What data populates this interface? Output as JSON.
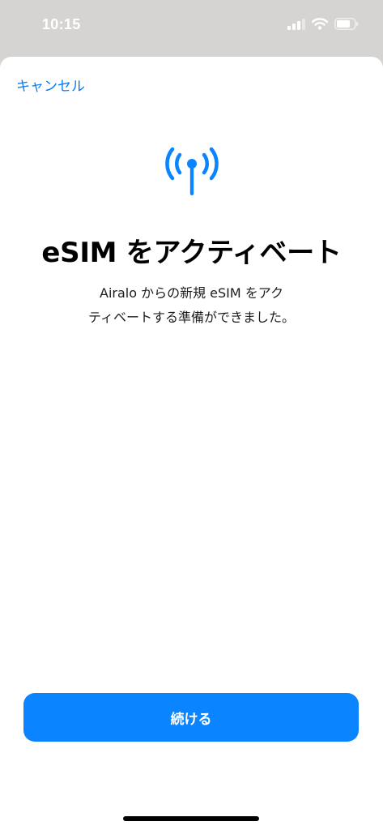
{
  "status_bar": {
    "time": "10:15",
    "icons": [
      "cellular-signal-icon",
      "wifi-icon",
      "battery-icon"
    ]
  },
  "sheet": {
    "cancel_label": "キャンセル",
    "hero_icon": "antenna-icon",
    "title": "eSIM をアクティベート",
    "description_lines": [
      "Airalo からの新規 eSIM をアク",
      "ティベートする準備ができました。"
    ],
    "continue_label": "続ける"
  },
  "colors": {
    "accent": "#0a84ff",
    "link": "#0a7bf5",
    "backdrop": "#d6d4d2"
  }
}
